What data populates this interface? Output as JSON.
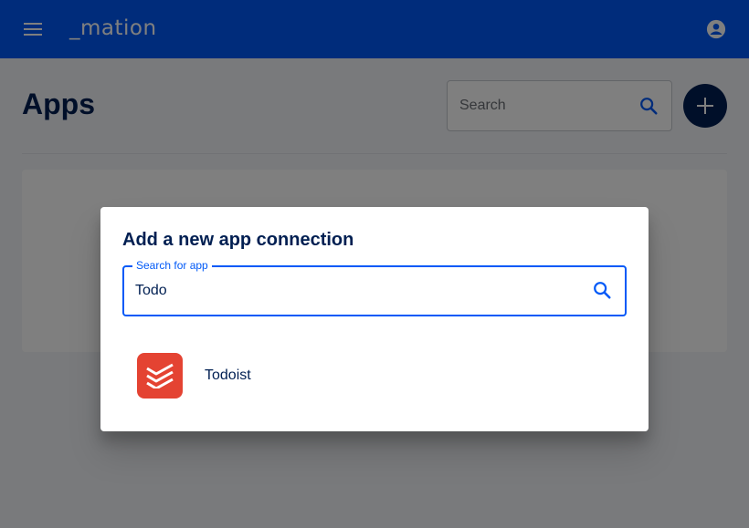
{
  "header": {
    "logo_text": "_mation",
    "menu_icon": "menu-icon",
    "account_icon": "account-circle-icon"
  },
  "page": {
    "title": "Apps",
    "search_placeholder": "Search",
    "add_icon": "plus-icon"
  },
  "dialog": {
    "title": "Add a new app connection",
    "search_label": "Search for app",
    "search_value": "Todo",
    "results": [
      {
        "name": "Todoist",
        "icon": "todoist-logo-icon"
      }
    ]
  },
  "colors": {
    "primary": "#0059f7",
    "dark": "#001f52",
    "todoist": "#e44332"
  }
}
